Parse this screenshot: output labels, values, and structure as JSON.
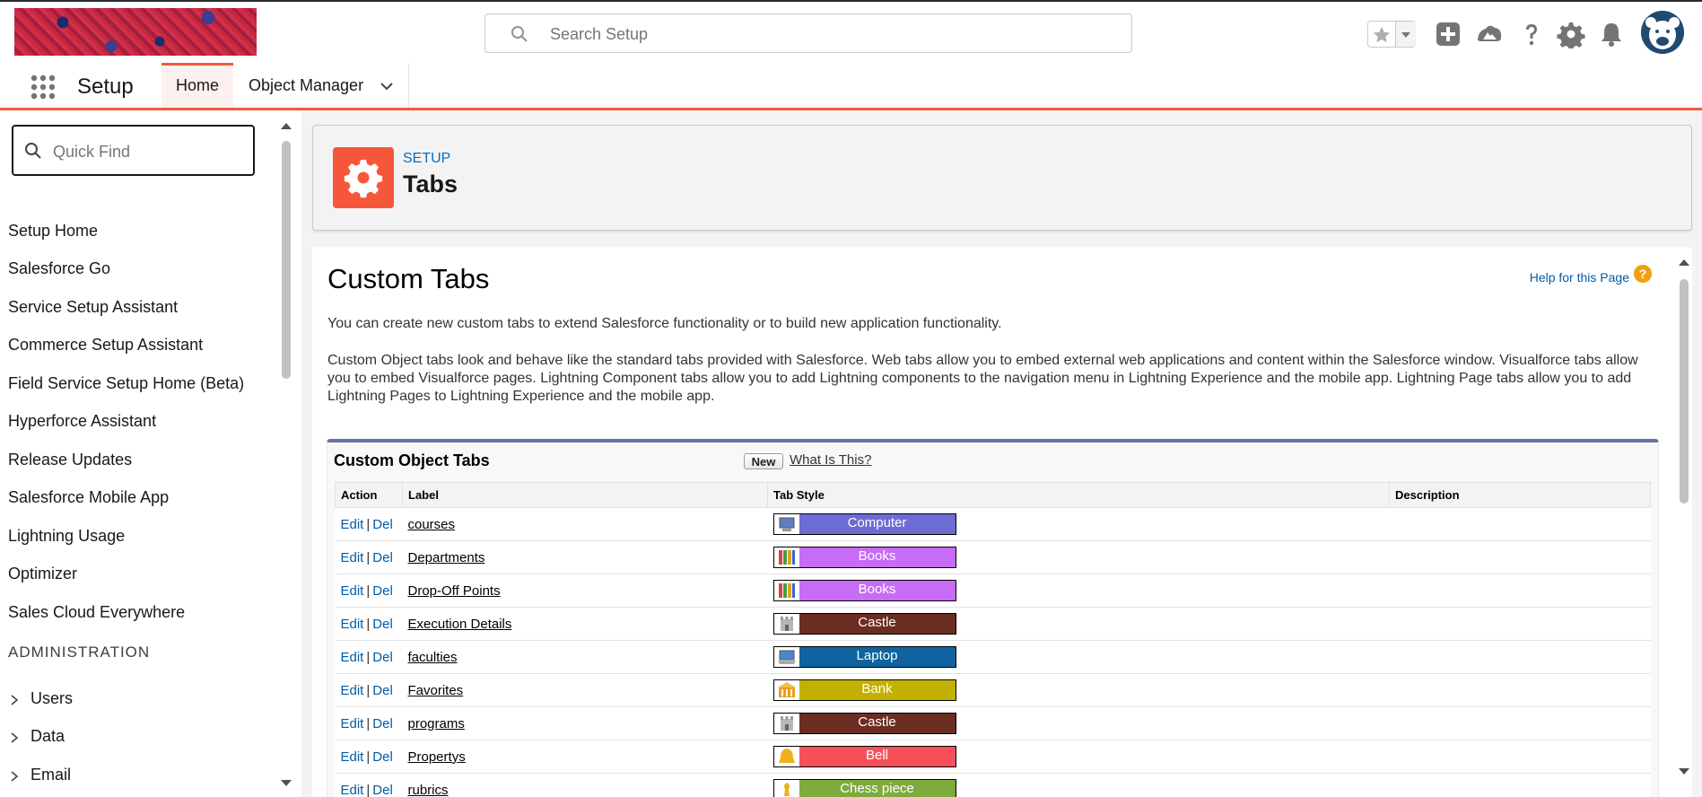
{
  "header": {
    "search_placeholder": "Search Setup",
    "icons": [
      "favorites-star-icon",
      "add-icon",
      "trailhead-icon",
      "help-icon",
      "gear-icon",
      "bell-icon",
      "avatar"
    ]
  },
  "nav": {
    "app_name": "Setup",
    "tabs": [
      {
        "label": "Home",
        "active": true
      },
      {
        "label": "Object Manager",
        "active": false
      }
    ]
  },
  "sidebar": {
    "quick_find_placeholder": "Quick Find",
    "items": [
      "Setup Home",
      "Salesforce Go",
      "Service Setup Assistant",
      "Commerce Setup Assistant",
      "Field Service Setup Home (Beta)",
      "Hyperforce Assistant",
      "Release Updates",
      "Salesforce Mobile App",
      "Lightning Usage",
      "Optimizer",
      "Sales Cloud Everywhere"
    ],
    "section_heading": "ADMINISTRATION",
    "section_items": [
      "Users",
      "Data",
      "Email"
    ]
  },
  "page_header": {
    "eyebrow": "SETUP",
    "title": "Tabs"
  },
  "content": {
    "title": "Custom Tabs",
    "help_link": "Help for this Page",
    "intro": "You can create new custom tabs to extend Salesforce functionality or to build new application functionality.",
    "description": "Custom Object tabs look and behave like the standard tabs provided with Salesforce. Web tabs allow you to embed external web applications and content within the Salesforce window. Visualforce tabs allow you to embed Visualforce pages. Lightning Component tabs allow you to add Lightning components to the navigation menu in Lightning Experience and the mobile app. Lightning Page tabs allow you to add Lightning Pages to Lightning Experience and the mobile app."
  },
  "custom_object_tabs": {
    "title": "Custom Object Tabs",
    "new_button": "New",
    "what_is_this": "What Is This?",
    "columns": [
      "Action",
      "Label",
      "Tab Style",
      "Description"
    ],
    "action_edit": "Edit",
    "action_sep": "|",
    "action_del": "Del",
    "rows": [
      {
        "label": "courses",
        "style": "Computer",
        "color": "#6d6bd4"
      },
      {
        "label": "Departments",
        "style": "Books",
        "color": "#c76cf5"
      },
      {
        "label": "Drop-Off Points",
        "style": "Books",
        "color": "#c76cf5"
      },
      {
        "label": "Execution Details",
        "style": "Castle",
        "color": "#6b2c22"
      },
      {
        "label": "faculties",
        "style": "Laptop",
        "color": "#0f639e"
      },
      {
        "label": "Favorites",
        "style": "Bank",
        "color": "#c4b000"
      },
      {
        "label": "programs",
        "style": "Castle",
        "color": "#6b2c22"
      },
      {
        "label": "Propertys",
        "style": "Bell",
        "color": "#f6515b"
      },
      {
        "label": "rubrics",
        "style": "Chess piece",
        "color": "#7dab3e"
      }
    ]
  }
}
